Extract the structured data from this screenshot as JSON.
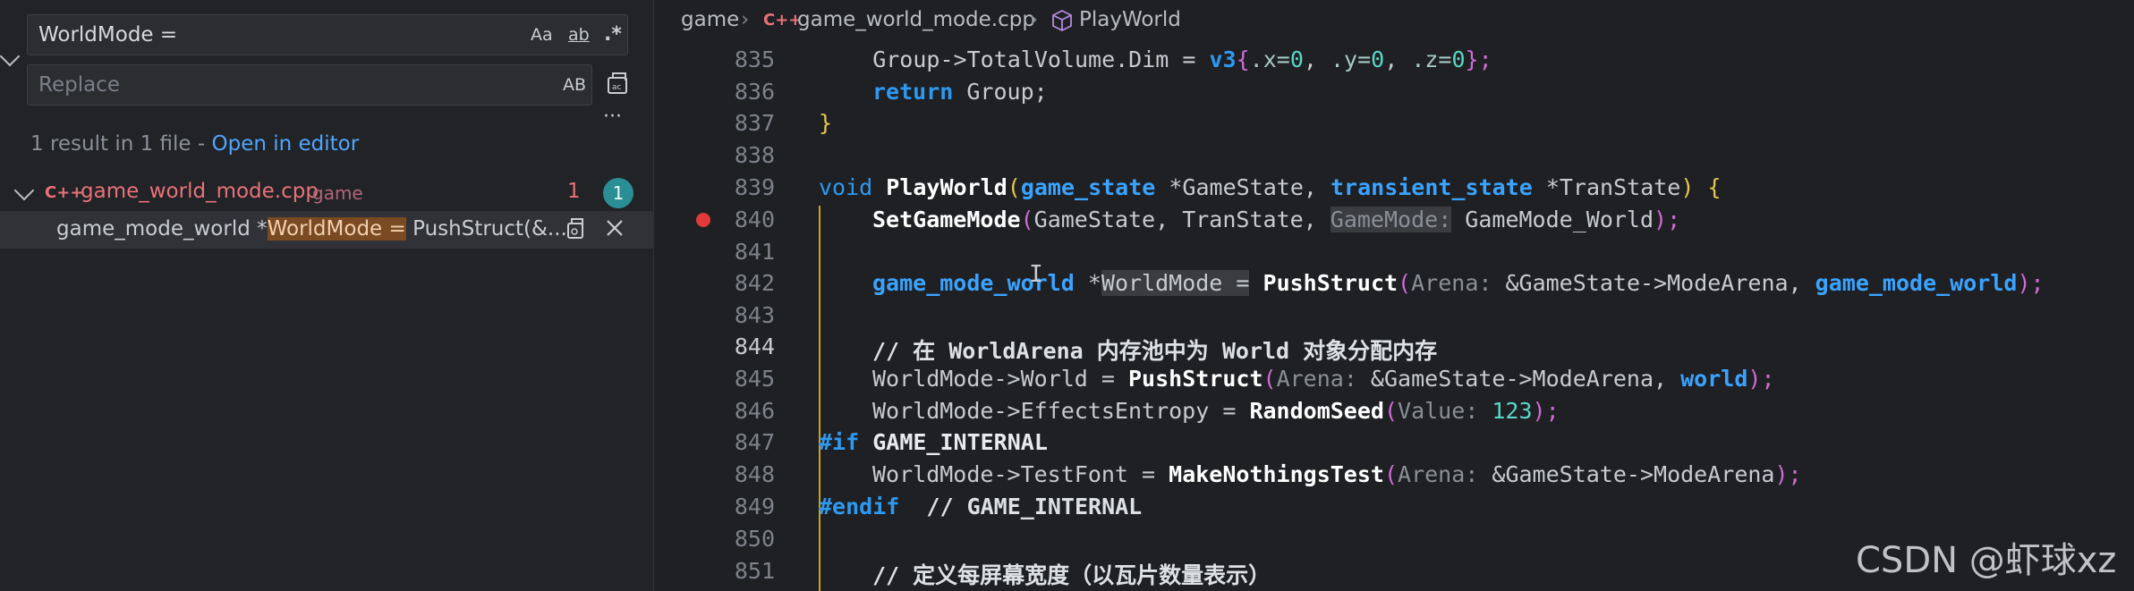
{
  "search": {
    "query": "WorldMode =",
    "replace_placeholder": "Replace",
    "match_case_label": "Aa",
    "whole_word_label": "ab",
    "regex_label": ".*",
    "preserve_case_label": "AB",
    "summary_prefix": "1 result in 1 file - ",
    "open_in_editor": "Open in editor",
    "more_label": "···",
    "file": {
      "icon": "C++",
      "name": "game_world_mode.cpp",
      "folder": "game",
      "count": "1",
      "badge": "1"
    },
    "match": {
      "before": "game_mode_world *",
      "highlight": "WorldMode =",
      "after": " PushStruct(&..."
    }
  },
  "breadcrumb": {
    "folder": "game",
    "file_icon": "C++",
    "file": "game_world_mode.cpp",
    "symbol_icon": "cube-icon",
    "symbol": "PlayWorld"
  },
  "line_numbers": [
    "835",
    "836",
    "837",
    "838",
    "839",
    "840",
    "841",
    "842",
    "843",
    "844",
    "845",
    "846",
    "847",
    "848",
    "849",
    "850",
    "851"
  ],
  "active_line": "844",
  "breakpoint_line": "840",
  "code": {
    "l835": {
      "a": "    Group->TotalVolume.Dim = ",
      "b": "v3",
      "c": "{",
      ".x": ".x=",
      "x": "0",
      "c1": ", ",
      ".y": ".y=",
      "y": "0",
      "c2": ", ",
      ".z": ".z=",
      "z": "0",
      "e": "};"
    },
    "l836": {
      "kw": "return",
      "rest": " Group;"
    },
    "l837": {
      "t": "}"
    },
    "l839": {
      "kw": "void",
      "sp": " ",
      "fn": "PlayWorld",
      "p1": "(",
      "t1": "game_state",
      "s1": " *GameState, ",
      "t2": "transient_state",
      "s2": " *TranState",
      "p2": ")",
      "sp2": " ",
      "br": "{"
    },
    "l840": {
      "fn": "SetGameMode",
      "p1": "(",
      "a": "GameState, TranState, ",
      "h": "GameMode:",
      "v": " GameMode_World",
      "p2": ");"
    },
    "l842": {
      "ty": "game_mode_world",
      "s": " *",
      "sel": "WorldMode =",
      "sp": " ",
      "fn": "PushStruct",
      "p1": "(",
      "h": "Arena:",
      "amp": " &",
      "v": "GameState->ModeArena, ",
      "ty2": "game_mode_world",
      "p2": ");"
    },
    "l844": {
      "c": "// 在 WorldArena 内存池中为 World 对象分配内存"
    },
    "l845": {
      "a": "WorldMode->World = ",
      "fn": "PushStruct",
      "p1": "(",
      "h": "Arena:",
      "amp": " &",
      "v": "GameState->ModeArena, ",
      "ty": "world",
      "p2": ");"
    },
    "l846": {
      "a": "WorldMode->EffectsEntropy = ",
      "fn": "RandomSeed",
      "p1": "(",
      "h": "Value:",
      "n": " 123",
      "p2": ");"
    },
    "l847": {
      "pp": "#if",
      "sp": " ",
      "w": "GAME_INTERNAL"
    },
    "l848": {
      "a": "WorldMode->TestFont = ",
      "fn": "MakeNothingsTest",
      "p1": "(",
      "h": "Arena:",
      "amp": " &",
      "v": "GameState->ModeArena",
      "p2": ");"
    },
    "l849": {
      "pp": "#endif",
      "c": "  // GAME_INTERNAL"
    },
    "l851": {
      "c": "// 定义每屏幕宽度（以瓦片数量表示）"
    }
  },
  "watermark": "CSDN @虾球xz",
  "colors": {
    "accent": "#4fa6ff",
    "file_match": "#e8727a",
    "badge": "#2a8f95",
    "breakpoint": "#e03a3a",
    "match_highlight": "#7a4a22"
  }
}
